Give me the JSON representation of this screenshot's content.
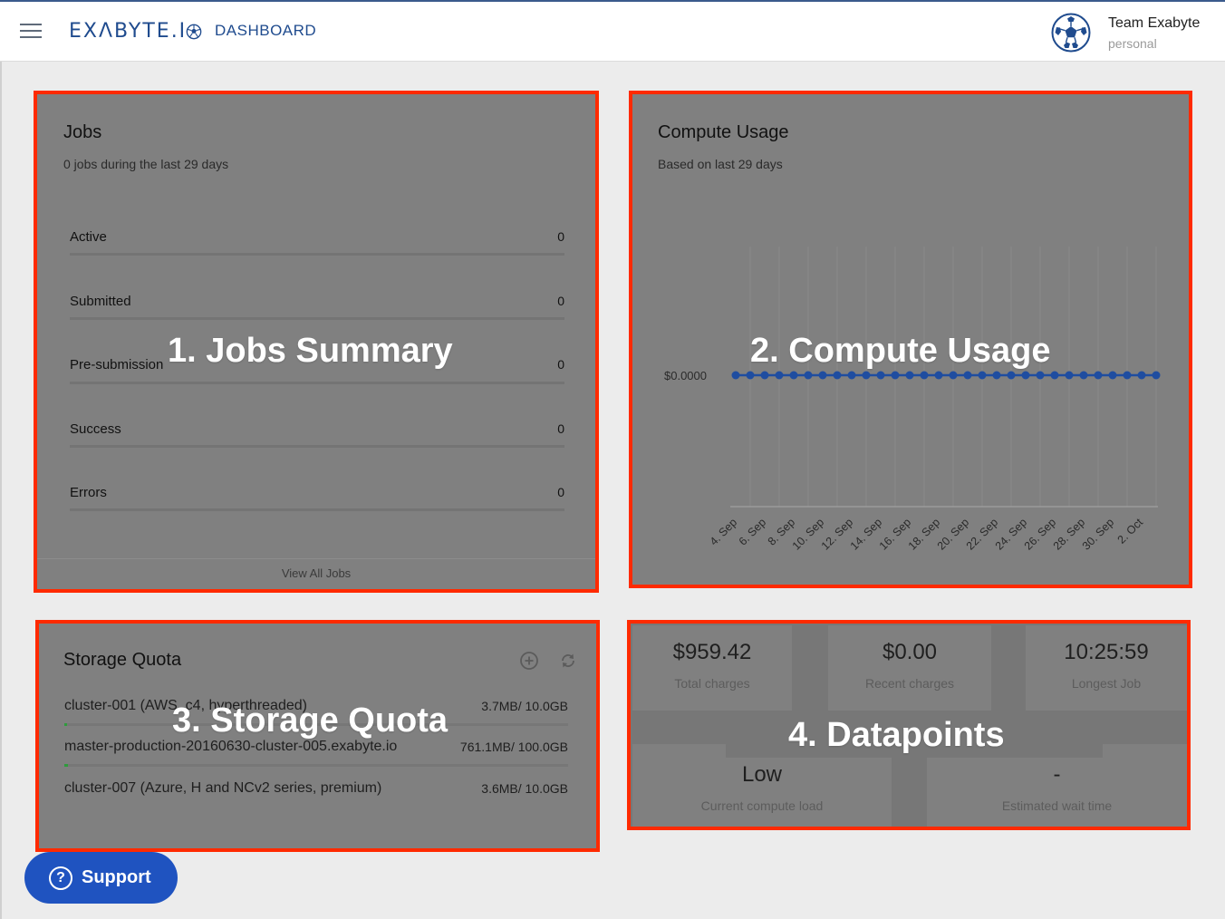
{
  "header": {
    "logo": "EXΛBYTE.I",
    "section": "DASHBOARD",
    "team_name": "Team Exabyte",
    "team_type": "personal"
  },
  "jobs": {
    "title": "Jobs",
    "subtitle": "0 jobs during the last 29 days",
    "rows": [
      {
        "label": "Active",
        "value": "0"
      },
      {
        "label": "Submitted",
        "value": "0"
      },
      {
        "label": "Pre-submission",
        "value": "0"
      },
      {
        "label": "Success",
        "value": "0"
      },
      {
        "label": "Errors",
        "value": "0"
      }
    ],
    "view_all": "View All Jobs",
    "overlay": "1. Jobs Summary"
  },
  "compute": {
    "title": "Compute Usage",
    "subtitle": "Based on last 29 days",
    "overlay": "2. Compute Usage"
  },
  "chart_data": {
    "type": "line",
    "title": "",
    "xlabel": "",
    "ylabel": "",
    "y_tick_labels": [
      "$0.0000"
    ],
    "x_tick_labels": [
      "4. Sep",
      "6. Sep",
      "8. Sep",
      "10. Sep",
      "12. Sep",
      "14. Sep",
      "16. Sep",
      "18. Sep",
      "20. Sep",
      "22. Sep",
      "24. Sep",
      "26. Sep",
      "28. Sep",
      "30. Sep",
      "2. Oct"
    ],
    "x": [
      "3. Sep",
      "4. Sep",
      "5. Sep",
      "6. Sep",
      "7. Sep",
      "8. Sep",
      "9. Sep",
      "10. Sep",
      "11. Sep",
      "12. Sep",
      "13. Sep",
      "14. Sep",
      "15. Sep",
      "16. Sep",
      "17. Sep",
      "18. Sep",
      "19. Sep",
      "20. Sep",
      "21. Sep",
      "22. Sep",
      "23. Sep",
      "24. Sep",
      "25. Sep",
      "26. Sep",
      "27. Sep",
      "28. Sep",
      "29. Sep",
      "30. Sep",
      "1. Oct",
      "2. Oct"
    ],
    "series": [
      {
        "values": [
          0,
          0,
          0,
          0,
          0,
          0,
          0,
          0,
          0,
          0,
          0,
          0,
          0,
          0,
          0,
          0,
          0,
          0,
          0,
          0,
          0,
          0,
          0,
          0,
          0,
          0,
          0,
          0,
          0,
          0
        ],
        "color": "#1f4da0"
      }
    ],
    "grid": true
  },
  "storage": {
    "title": "Storage Quota",
    "rows": [
      {
        "name": "cluster-001 (AWS, c4, hyperthreaded)",
        "size": "3.7MB/ 10.0GB",
        "fill": 0.0004
      },
      {
        "name": "master-production-20160630-cluster-005.exabyte.io",
        "size": "761.1MB/ 100.0GB",
        "fill": 0.0076
      },
      {
        "name": "cluster-007 (Azure, H and NCv2 series, premium)",
        "size": "3.6MB/ 10.0GB",
        "fill": 0.0004
      }
    ],
    "add_icon": "plus-circle-icon",
    "refresh_icon": "refresh-icon",
    "overlay": "3. Storage Quota"
  },
  "datapoints": {
    "tiles": [
      {
        "value": "$959.42",
        "label": "Total charges"
      },
      {
        "value": "$0.00",
        "label": "Recent charges"
      },
      {
        "value": "10:25:59",
        "label": "Longest Job"
      },
      {
        "value": "Low",
        "label": "Current compute load"
      },
      {
        "value": "-",
        "label": "Estimated wait time"
      }
    ],
    "overlay": "4. Datapoints"
  },
  "support": {
    "label": "Support",
    "icon": "?"
  },
  "colors": {
    "brand": "#1f4b8e",
    "highlight_border": "#ff2a00",
    "support_button": "#1f53c0",
    "series": "#1f4da0"
  }
}
